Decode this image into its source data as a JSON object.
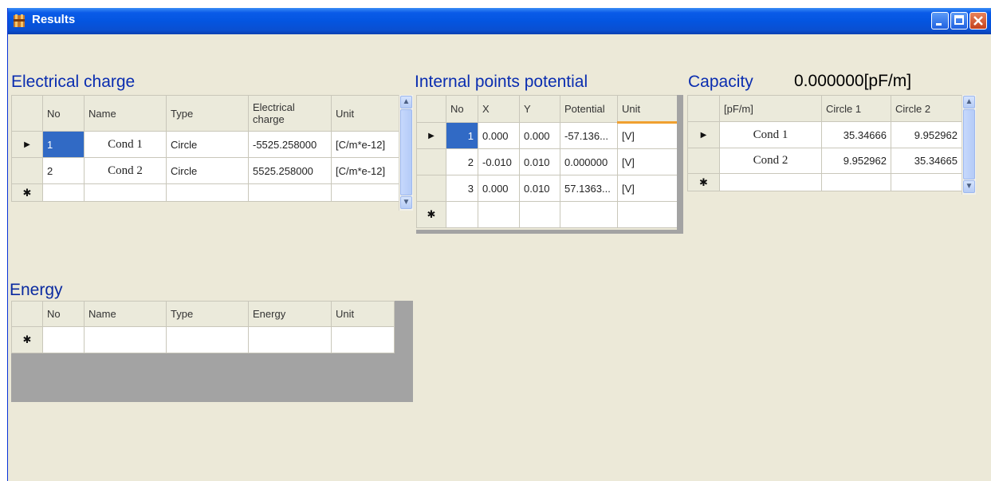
{
  "window": {
    "title": "Results",
    "icon": "app-icon",
    "controls": [
      "minimize-icon",
      "maximize-icon",
      "close-icon"
    ]
  },
  "electrical_charge": {
    "title": "Electrical charge",
    "columns": [
      "No",
      "Name",
      "Type",
      "Electrical charge",
      "Unit"
    ],
    "rows": [
      {
        "no": "1",
        "name": "Cond 1",
        "type": "Circle",
        "charge": "-5525.258000",
        "unit": "[C/m*e-12]"
      },
      {
        "no": "2",
        "name": "Cond 2",
        "type": "Circle",
        "charge": "5525.258000",
        "unit": "[C/m*e-12]"
      }
    ]
  },
  "internal_points": {
    "title": "Internal points potential",
    "columns": [
      "No",
      "X",
      "Y",
      "Potential",
      "Unit"
    ],
    "rows": [
      {
        "no": "1",
        "x": "0.000",
        "y": "0.000",
        "potential": "-57.136...",
        "unit": "[V]"
      },
      {
        "no": "2",
        "x": "-0.010",
        "y": "0.010",
        "potential": "0.000000",
        "unit": "[V]"
      },
      {
        "no": "3",
        "x": "0.000",
        "y": "0.010",
        "potential": "57.1363...",
        "unit": "[V]"
      }
    ]
  },
  "capacity": {
    "title": "Capacity",
    "value": "0.000000[pF/m]",
    "columns": [
      "[pF/m]",
      "Circle 1",
      "Circle 2"
    ],
    "rows": [
      {
        "name": "Cond 1",
        "c1": "35.34666",
        "c2": "9.952962"
      },
      {
        "name": "Cond 2",
        "c1": "9.952962",
        "c2": "35.34665"
      }
    ]
  },
  "energy": {
    "title": "Energy",
    "columns": [
      "No",
      "Name",
      "Type",
      "Energy",
      "Unit"
    ]
  },
  "markers": {
    "current_row": "▶",
    "new_row": "✱"
  },
  "colors": {
    "titlebar": "#0455e0",
    "section_title": "#0a2db0",
    "selection": "#316ac5",
    "window_bg": "#ece9d8"
  }
}
